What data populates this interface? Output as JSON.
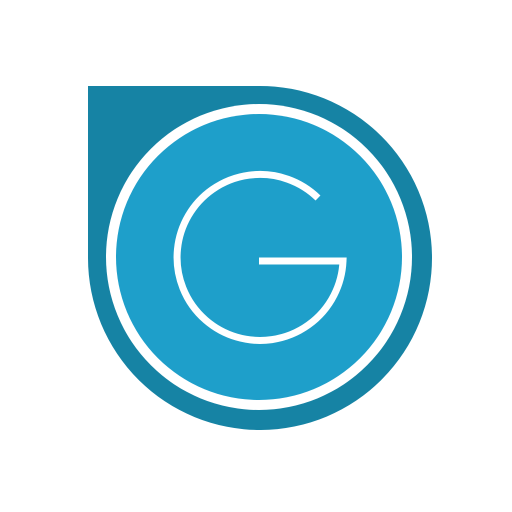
{
  "logo": {
    "icon": "g-letter-drop-logo-icon",
    "colors": {
      "background": "#ffffff",
      "outer_shape": "#1683a4",
      "ring": "#ffffff",
      "inner_circle": "#1e9fca",
      "letter": "#ffffff"
    }
  }
}
